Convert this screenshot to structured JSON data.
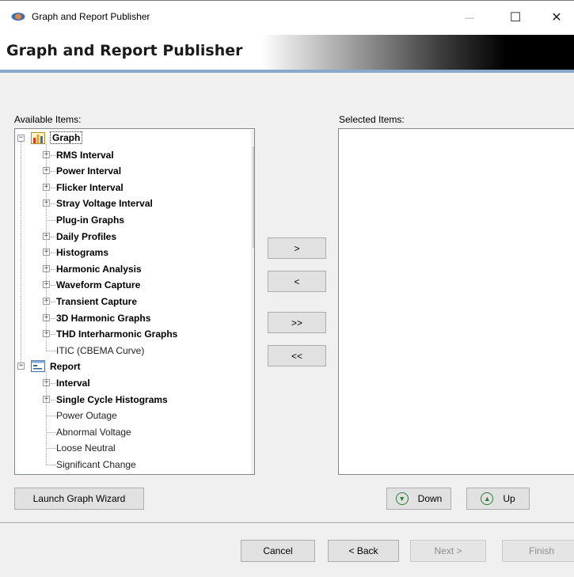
{
  "window": {
    "title": "Graph and Report Publisher",
    "minimize_glyph": "—",
    "maximize_glyph": "☐",
    "close_glyph": "✕"
  },
  "header": {
    "title": "Graph and Report Publisher"
  },
  "available": {
    "label": "Available Items:",
    "tree": [
      {
        "label": "Graph",
        "bold": true,
        "level": 0,
        "expander": "minus",
        "icon": "graph-icon",
        "highlighted": true
      },
      {
        "label": "RMS Interval",
        "bold": true,
        "level": 1,
        "expander": "plus"
      },
      {
        "label": "Power Interval",
        "bold": true,
        "level": 1,
        "expander": "plus"
      },
      {
        "label": "Flicker Interval",
        "bold": true,
        "level": 1,
        "expander": "plus"
      },
      {
        "label": "Stray Voltage Interval",
        "bold": true,
        "level": 1,
        "expander": "plus"
      },
      {
        "label": "Plug-in Graphs",
        "bold": true,
        "level": 1,
        "expander": "none"
      },
      {
        "label": "Daily Profiles",
        "bold": true,
        "level": 1,
        "expander": "plus"
      },
      {
        "label": "Histograms",
        "bold": true,
        "level": 1,
        "expander": "plus"
      },
      {
        "label": "Harmonic Analysis",
        "bold": true,
        "level": 1,
        "expander": "plus"
      },
      {
        "label": "Waveform Capture",
        "bold": true,
        "level": 1,
        "expander": "plus"
      },
      {
        "label": "Transient Capture",
        "bold": true,
        "level": 1,
        "expander": "plus"
      },
      {
        "label": "3D Harmonic Graphs",
        "bold": true,
        "level": 1,
        "expander": "plus"
      },
      {
        "label": "THD Interharmonic Graphs",
        "bold": true,
        "level": 1,
        "expander": "plus"
      },
      {
        "label": "ITIC (CBEMA Curve)",
        "bold": false,
        "level": 1,
        "expander": "none"
      },
      {
        "label": "Report",
        "bold": true,
        "level": 0,
        "expander": "minus",
        "icon": "report-icon"
      },
      {
        "label": "Interval",
        "bold": true,
        "level": 1,
        "expander": "plus"
      },
      {
        "label": "Single Cycle Histograms",
        "bold": true,
        "level": 1,
        "expander": "plus"
      },
      {
        "label": "Power Outage",
        "bold": false,
        "level": 1,
        "expander": "none"
      },
      {
        "label": "Abnormal Voltage",
        "bold": false,
        "level": 1,
        "expander": "none"
      },
      {
        "label": "Loose Neutral",
        "bold": false,
        "level": 1,
        "expander": "none"
      },
      {
        "label": "Significant Change",
        "bold": false,
        "level": 1,
        "expander": "none"
      }
    ]
  },
  "selected": {
    "label": "Selected Items:",
    "items": []
  },
  "transfer": {
    "add": ">",
    "remove": "<",
    "add_all": ">>",
    "remove_all": "<<"
  },
  "launch_wizard": "Launch Graph Wizard",
  "order": {
    "down": "Down",
    "up": "Up"
  },
  "footer": {
    "cancel": "Cancel",
    "back": "< Back",
    "next": "Next >",
    "finish": "Finish"
  },
  "colors": {
    "banner_line": "#8aa8cc",
    "disabled_text": "#8d8d8d",
    "order_icon": "#2e7d32"
  }
}
